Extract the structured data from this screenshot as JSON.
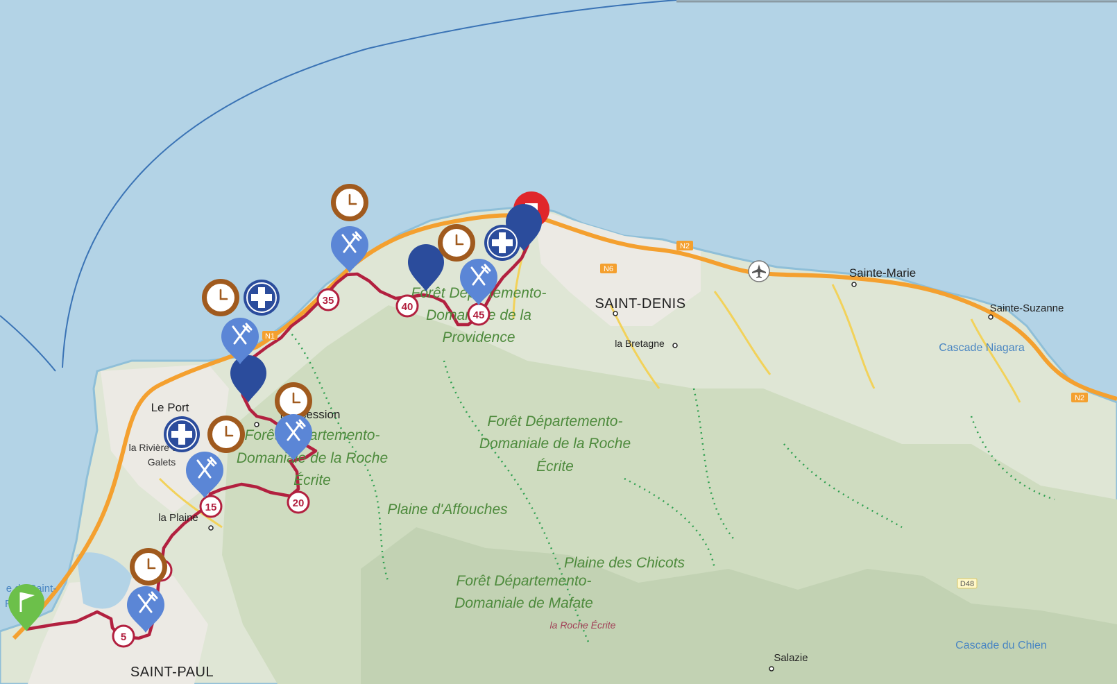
{
  "map": {
    "places": {
      "saint_denis": "SAINT-DENIS",
      "saint_paul": "SAINT-PAUL",
      "le_port": "Le Port",
      "la_riviere_1": "la Rivière des",
      "la_riviere_2": "Galets",
      "la_possession": "Possession",
      "sainte_marie": "Sainte-Marie",
      "sainte_suzanne": "Sainte-Suzanne",
      "la_bretagne": "la Bretagne",
      "salazie": "Salazie",
      "la_plaine": "la Plaine",
      "cascade_niagara": "Cascade Niagara",
      "cascade_chien": "Cascade du Chien",
      "la_roche_ecrite": "la Roche Écrite",
      "baie_1": "e de Saint-",
      "baie_2": "Paul"
    },
    "forests": {
      "providence": [
        "Forêt Départemento-",
        "Domaniale de la",
        "Providence"
      ],
      "roche_ecrite_east": [
        "Forêt Départemento-",
        "Domaniale de la Roche",
        "Écrite"
      ],
      "roche_ecrite_west": [
        "Forêt Départemento-",
        "Domaniale de la Roche",
        "Écrite"
      ],
      "affouches": "Plaine d'Affouches",
      "chicots": "Plaine des Chicots",
      "mafate": [
        "Forêt Départemento-",
        "Domaniale de Mafate"
      ]
    },
    "roads": {
      "n2_west": "N2",
      "n6": "N6",
      "n2_east": "N2",
      "n1": "N1",
      "d48": "D48"
    },
    "km_markers": [
      "5",
      "10",
      "15",
      "20",
      "35",
      "40",
      "45"
    ],
    "markers": {
      "start": "start-flag-icon",
      "finish": "finish-flag-icon",
      "aid": "first-aid-icon",
      "food": "fork-knife-icon",
      "time": "clock-icon",
      "waypoint": "waypoint-pin-icon"
    },
    "colors": {
      "sea": "#b3d3e6",
      "land": "#dfe6d5",
      "route": "#b2203f",
      "highway": "#f4a02f",
      "food_marker": "#5b86d6",
      "aid_marker": "#2b4c9c",
      "time_marker": "#a05a1e",
      "start": "#6cc04a",
      "finish": "#e0262b"
    }
  }
}
